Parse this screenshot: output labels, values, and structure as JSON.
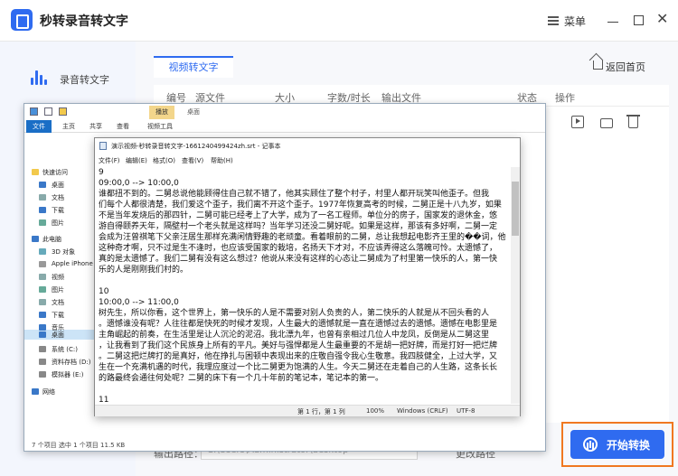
{
  "app": {
    "name": "秒转录音转文字",
    "menu_label": "菜单"
  },
  "sidebar": {
    "item_label": "录音转文字"
  },
  "main": {
    "tab_label": "视频转文字",
    "home_label": "返回首页",
    "columns": [
      "编号",
      "源文件",
      "大小",
      "字数/时长",
      "输出文件",
      "状态",
      "操作"
    ],
    "output_label": "输出路径：",
    "output_path": "C:\\Users\\Administrator\\desktop",
    "change_path_label": "更改路径",
    "start_label": "开始转换"
  },
  "explorer": {
    "play_tab": "播放",
    "title": "桌面",
    "ribbon_tabs": [
      "文件",
      "主页",
      "共享",
      "查看",
      "视频工具"
    ],
    "nav": [
      "快速访问",
      "桌面",
      "文档",
      "下载",
      "图片",
      "此电脑",
      "3D 对象",
      "Apple iPhone",
      "视频",
      "图片",
      "文档",
      "下载",
      "音乐",
      "桌面",
      "系统 (C:)",
      "资料存档 (D:)",
      "模拟器 (E:)",
      "网络"
    ],
    "status": "7 个项目    选中 1 个项目  11.5 KB"
  },
  "notepad": {
    "title": "演示视频-秒转录音转文字-1661240499424zh.srt - 记事本",
    "menu": [
      "文件(F)",
      "编辑(E)",
      "格式(O)",
      "查看(V)",
      "帮助(H)"
    ],
    "lines": [
      "9",
      "09:00,0 --> 10:00,0",
      " 谁都扭不到的。二舅总说他能顾得住自己就不错了，他其实顾住了整个村子，村里人都开玩笑叫他歪子。但我",
      "们每个人都很清楚，我们爱这个歪子，我们离不开这个歪子。1977年恢复高考的时候，二舅正是十八九岁，如果",
      "不是当年发烧后的那四针，二舅可能已经考上了大学，成为了一名工程师。单位分的房子，国家发的退休金，悠",
      "游自得颐养天年，隔壁村一个老头就是这样吗？当年学习还没二舅好呢。如果是这样，那该有多好啊，二舅一定",
      "会成为汪曾祺笔下父亲汪居生那样充满闲情野趣的老顽童。看着眼前的二舅，总让我想起电影齐王里的��词，他",
      "这种奇才啊，只不过是生不逢时，也应该受国家的栽培，名扬天下才对，不应该弄得这么落魄可怜。太遗憾了，",
      "真的是太遗憾了。我们二舅有没有这么想过？他说从来没有这样的心态让二舅成为了村里第一快乐的人，第一快",
      "乐的人是刚刚我们村的。",
      "",
      "10",
      "10:00,0 --> 11:00,0",
      " 树先生，所以你看，这个世界上，第一快乐的人是不需要对别人负责的人，第二快乐的人就是从不回头看的人",
      "。遗憾谁没有呢？人往往都是快死的时候才发现，人生最大的遗憾就是一直在遗憾过去的遗憾。遗憾在电影里是",
      "主角崛起的前奏，在生活里是让人沉沦的泥沼。我北漂九年，也曾有亲相过几位人中龙凤，反倒是从二舅这里",
      "，让我看到了我们这个民族身上所有的平凡。美好与强悍都是人生最重要的不是胡一把好牌，而是打好一把烂牌",
      "。二舅这把烂牌打的是真好，他在挣扎与困顿中表现出来的庄敬自强令我心生敬意。我四肢健全，上过大学，又",
      "生在一个充满机遇的时代，我理应度过一个比二舅更为饱满的人生。今天二舅还在走着自己的人生路，这条长长",
      "的路最终会通往何处呢？二舅的床下有一个几十年前的笔记本，笔记本的第一。",
      "",
      "11"
    ],
    "status_pos": "第 1 行，第 1 列",
    "status_zoom": "100%",
    "status_eol": "Windows (CRLF)",
    "status_enc": "UTF-8"
  }
}
